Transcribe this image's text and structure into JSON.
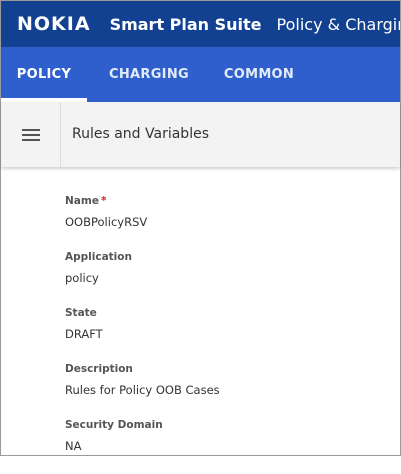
{
  "header": {
    "brand": "NOKIA",
    "suite": "Smart Plan Suite",
    "product": "Policy & Charging"
  },
  "tabs": [
    {
      "label": "POLICY",
      "active": true
    },
    {
      "label": "CHARGING",
      "active": false
    },
    {
      "label": "COMMON",
      "active": false
    }
  ],
  "subheader": {
    "menu_icon": "hamburger-menu-icon",
    "title": "Rules and Variables"
  },
  "fields": [
    {
      "label": "Name",
      "required_marker": "*",
      "value": "OOBPolicyRSV"
    },
    {
      "label": "Application",
      "value": "policy"
    },
    {
      "label": "State",
      "value": "DRAFT"
    },
    {
      "label": "Description",
      "value": "Rules for Policy OOB Cases"
    },
    {
      "label": "Security Domain",
      "value": "NA"
    }
  ],
  "colors": {
    "header_bg": "#124191",
    "tabbar_bg": "#2e5fcc",
    "subheader_bg": "#f3f3f3",
    "required": "#cc2222"
  }
}
